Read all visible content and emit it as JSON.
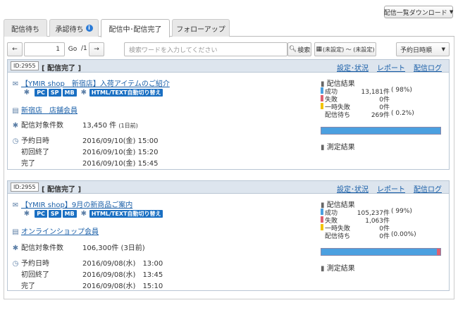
{
  "header": {
    "download_label": "配信一覧ダウンロード"
  },
  "tabs": [
    {
      "label": "配信待ち"
    },
    {
      "label": "承認待ち",
      "badge": "i"
    },
    {
      "label": "配信中･配信完了"
    },
    {
      "label": "フォローアップ"
    }
  ],
  "toolbar": {
    "page_value": "1",
    "go_label": "Go",
    "page_total": "/1",
    "search_placeholder": "検索ワードを入力してください",
    "search_label": "検索",
    "date_range": "(未設定) 〜 (未設定)",
    "sort_value": "予約日時順"
  },
  "cards": [
    {
      "id": "ID:2955",
      "status": "[ 配信完了 ]",
      "links": [
        "設定･状況",
        "レポート",
        "配信ログ"
      ],
      "subject": "【YMIR shop　新宿店】入荷アイテムのご紹介",
      "tags": [
        "PC",
        "SP",
        "MB"
      ],
      "format": "HTML/TEXT自動切り替え",
      "group": "新宿店　店舗会員",
      "count_label": "配信対象件数",
      "count_value": "13,450 件",
      "count_days": "(1日前)",
      "times": [
        {
          "label": "予約日時",
          "value": "2016/09/10(金) 15:00"
        },
        {
          "label": "初回終了",
          "value": "2016/09/10(金) 15:20"
        },
        {
          "label": "完了",
          "value": "2016/09/10(金) 15:45"
        }
      ],
      "result_title": "配信結果",
      "results": [
        {
          "label": "成功",
          "value": "13,181件",
          "pct": "( 98%)",
          "color": "#4ba0e0"
        },
        {
          "label": "失敗",
          "value": "0件",
          "pct": "",
          "color": "#e06070"
        },
        {
          "label": "一時失敗",
          "value": "0件",
          "pct": "",
          "color": "#f2c40c"
        },
        {
          "label": "配信待ち",
          "value": "269件",
          "pct": "( 0.2%)",
          "color": ""
        }
      ],
      "bar_fail_fraction": 0.0,
      "measure_label": "測定結果"
    },
    {
      "id": "ID:2955",
      "status": "[ 配信完了 ]",
      "links": [
        "設定･状況",
        "レポート",
        "配信ログ"
      ],
      "subject": "【YMIR shop】9月の新商品ご案内",
      "tags": [
        "PC",
        "SP",
        "MB"
      ],
      "format": "HTML/TEXT自動切り替え",
      "group": "オンラインショップ会員",
      "count_label": "配信対象件数",
      "count_value": "106,300件",
      "count_days": "(3日前)",
      "times": [
        {
          "label": "予約日時",
          "value": "2016/09/08(水)　13:00"
        },
        {
          "label": "初回終了",
          "value": "2016/09/08(水)　13:45"
        },
        {
          "label": "完了",
          "value": "2016/09/08(水)　15:10"
        }
      ],
      "result_title": "配信結果",
      "results": [
        {
          "label": "成功",
          "value": "105,237件",
          "pct": "( 99%)",
          "color": "#4ba0e0"
        },
        {
          "label": "失敗",
          "value": "1,063件",
          "pct": "",
          "color": "#e06070"
        },
        {
          "label": "一時失敗",
          "value": "0件",
          "pct": "",
          "color": "#f2c40c"
        },
        {
          "label": "配信待ち",
          "value": "0件",
          "pct": "(0.00%)",
          "color": ""
        }
      ],
      "bar_fail_fraction": 0.01,
      "measure_label": "測定結果"
    }
  ]
}
